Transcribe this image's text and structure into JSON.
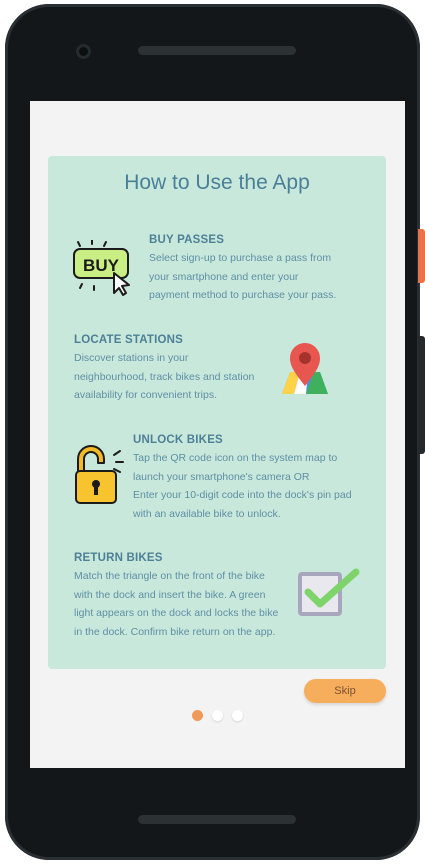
{
  "title": "How to Use the App",
  "sections": [
    {
      "title": "BUY PASSES",
      "lines": [
        "Select sign-up to purchase a pass from",
        "your smartphone and enter your",
        "payment method to purchase your pass."
      ],
      "icon": "buy-icon",
      "icon_text": "BUY"
    },
    {
      "title": "LOCATE STATIONS",
      "lines": [
        "Discover stations in your",
        "neighbourhood, track bikes and station",
        "availability for convenient trips."
      ],
      "icon": "map-pin-icon"
    },
    {
      "title": "UNLOCK BIKES",
      "lines": [
        "Tap the QR code icon on the system map to",
        "launch your smartphone's camera OR",
        "Enter your 10-digit code into the dock's pin pad",
        "with an available bike to unlock."
      ],
      "icon": "padlock-icon"
    },
    {
      "title": "RETURN BIKES",
      "lines": [
        "Match the triangle on the front of the bike",
        "with the dock and insert the bike. A green",
        "light appears on the dock and locks the bike",
        "in the dock. Confirm bike return on the app."
      ],
      "icon": "checkbox-icon"
    }
  ],
  "skip_label": "Skip",
  "pagination": {
    "total": 3,
    "active": 1
  },
  "colors": {
    "card_background": "#c9e8dc",
    "title": "#4a7f98",
    "skip_button": "#f6ad5c",
    "active_dot": "#ef9a5a"
  }
}
